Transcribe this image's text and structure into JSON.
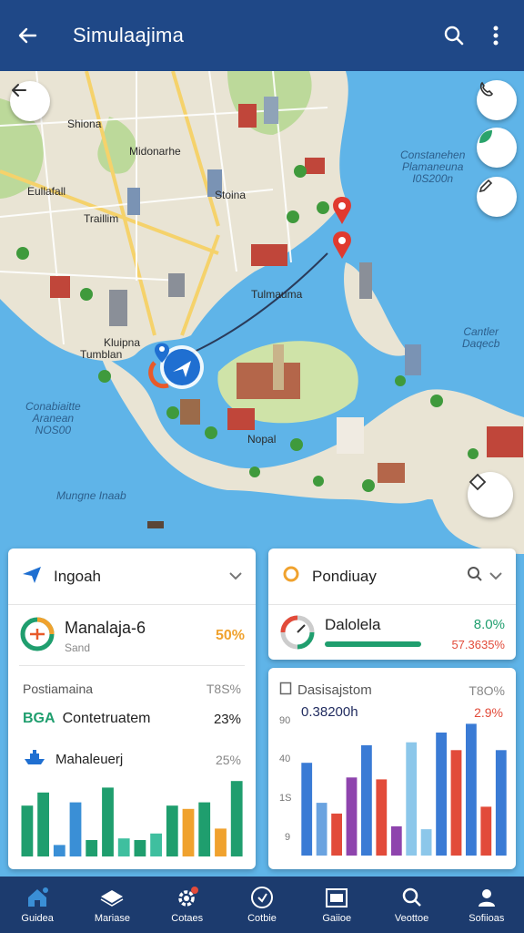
{
  "appbar": {
    "title": "Simulaajima"
  },
  "map": {
    "labels": {
      "shiona": "Shiona",
      "midonarhe": "Midonarhe",
      "stoina": "Stoina",
      "eullafall": "Eullafall",
      "traillim": "Traillim",
      "tulmauma": "Tulmauma",
      "kluipna": "Kluipna",
      "tumblan": "Tumblan",
      "nopal": "Nopal",
      "mungne": "Mungne Inaab",
      "constanehen": "Constanehen\nPlamaneuna\nI0S200n",
      "conabiaitte": "Conabiaitte\nAranean\nNOS00",
      "cantler": "Cantler\nDaqecb"
    }
  },
  "card_left": {
    "title": "Ingoah",
    "item1": {
      "name": "Manalaja-6",
      "sub": "Sand",
      "value": "50%"
    },
    "section": {
      "label": "Postiamaina",
      "value": "T8S%"
    },
    "row2": {
      "code": "BGA",
      "name": "Contetruatem",
      "value": "23%"
    },
    "row3": {
      "name": "Mahaleuerj",
      "value": "25%"
    }
  },
  "card_right": {
    "title": "Pondiuay",
    "item1": {
      "name": "Dalolela",
      "value": "8.0%",
      "value2": "57.3635%"
    },
    "section": {
      "label": "Dasisajstom",
      "value": "T8O%"
    },
    "row2": {
      "name": "0.38200h",
      "value": "2.9%"
    },
    "y_ticks": [
      "90",
      "40",
      "1S",
      "9"
    ]
  },
  "chart_data": [
    {
      "type": "bar",
      "title": "",
      "xlabel": "",
      "ylabel": "",
      "values": [
        62,
        78,
        14,
        66,
        20,
        84,
        22,
        20,
        28,
        62,
        58,
        66,
        34,
        92
      ],
      "colors": [
        "#1f9e6e",
        "#1f9e6e",
        "#3a8fd6",
        "#3a8fd6",
        "#1f9e6e",
        "#1f9e6e",
        "#3fbf9f",
        "#1f9e6e",
        "#3fbf9f",
        "#1f9e6e",
        "#f0a22e",
        "#1f9e6e",
        "#f0a22e",
        "#1f9e6e"
      ]
    },
    {
      "type": "bar",
      "title": "",
      "xlabel": "",
      "ylabel": "",
      "values": [
        95,
        54,
        43,
        80,
        113,
        78,
        30,
        116,
        27,
        126,
        108,
        135,
        50,
        108
      ],
      "colors": [
        "#3a7bd5",
        "#6aa3e0",
        "#e24b3a",
        "#8e44ad",
        "#3a7bd5",
        "#e24b3a",
        "#8e44ad",
        "#8cc7ea",
        "#8cc7ea",
        "#3a7bd5",
        "#e24b3a",
        "#3a7bd5",
        "#e24b3a",
        "#3a7bd5"
      ]
    }
  ],
  "nav": [
    {
      "label": "Guidea",
      "icon": "home-icon"
    },
    {
      "label": "Mariase",
      "icon": "map-icon"
    },
    {
      "label": "Cotaes",
      "icon": "settings-icon"
    },
    {
      "label": "Cotbie",
      "icon": "compass-icon"
    },
    {
      "label": "Gaiioe",
      "icon": "calendar-icon"
    },
    {
      "label": "Veottoe",
      "icon": "search-icon"
    },
    {
      "label": "Sofiioas",
      "icon": "profile-icon"
    }
  ]
}
